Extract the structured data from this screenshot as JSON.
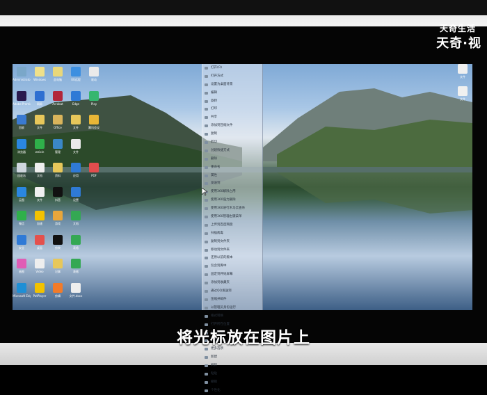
{
  "watermark": {
    "line1": "天奇生活",
    "line2": "天奇·视"
  },
  "subtitle": "将光标放在图片上",
  "desktop_icons": [
    {
      "label": "Administrator",
      "color": "#7aa7c9"
    },
    {
      "label": "Windows",
      "color": "#efe08a"
    },
    {
      "label": "此电脑",
      "color": "#e8d77a"
    },
    {
      "label": "UU远程",
      "color": "#3d8fe0"
    },
    {
      "label": "驱动",
      "color": "#eaeaea"
    },
    {
      "label": "Adobe Premiere",
      "color": "#2a1a4f"
    },
    {
      "label": "网易",
      "color": "#2e6fd1"
    },
    {
      "label": "Acrobat",
      "color": "#b2263a"
    },
    {
      "label": "Edge",
      "color": "#2f7ad6"
    },
    {
      "label": "Play",
      "color": "#36b66f"
    },
    {
      "label": "回收",
      "color": "#3a7ad1"
    },
    {
      "label": "文件",
      "color": "#e7c75a"
    },
    {
      "label": "Ofﬁce",
      "color": "#d9b45b"
    },
    {
      "label": "文件",
      "color": "#e7c75a"
    },
    {
      "label": "腾讯会议",
      "color": "#e8b636"
    },
    {
      "label": "浏览器",
      "color": "#2a87e0"
    },
    {
      "label": "weixin",
      "color": "#2fb04a"
    },
    {
      "label": "管理",
      "color": "#3a87c7"
    },
    {
      "label": "文件",
      "color": "#eaeaea"
    },
    {
      "label": "",
      "color": "#000000"
    },
    {
      "label": "回收站",
      "color": "#cfd6de"
    },
    {
      "label": "文档",
      "color": "#eeeeee"
    },
    {
      "label": "资料",
      "color": "#e7c75a"
    },
    {
      "label": "应用",
      "color": "#2f7ad6"
    },
    {
      "label": "PDF",
      "color": "#e24d4d"
    },
    {
      "label": "云图",
      "color": "#2a87e0"
    },
    {
      "label": "文件",
      "color": "#f0f0f0"
    },
    {
      "label": "抖音",
      "color": "#111111"
    },
    {
      "label": "设置",
      "color": "#2f7ad6"
    },
    {
      "label": "",
      "color": "#000000"
    },
    {
      "label": "微信",
      "color": "#2fb04a"
    },
    {
      "label": "加速",
      "color": "#f2c200"
    },
    {
      "label": "游戏",
      "color": "#e8a63a"
    },
    {
      "label": "文档",
      "color": "#34a853"
    },
    {
      "label": "",
      "color": "#000000"
    },
    {
      "label": "安全",
      "color": "#2f7ad6"
    },
    {
      "label": "桌面",
      "color": "#e4514d"
    },
    {
      "label": "剪映",
      "color": "#111111"
    },
    {
      "label": "表格",
      "color": "#34a853"
    },
    {
      "label": "",
      "color": "#000000"
    },
    {
      "label": "画图",
      "color": "#e05db5"
    },
    {
      "label": "Video",
      "color": "#eeeeee"
    },
    {
      "label": "记事",
      "color": "#e7c75a"
    },
    {
      "label": "表格",
      "color": "#34a853"
    },
    {
      "label": "",
      "color": "#000000"
    },
    {
      "label": "Microsoft Edge",
      "color": "#1e8fd6"
    },
    {
      "label": "PotPlayer",
      "color": "#f2c200"
    },
    {
      "label": "剪辑",
      "color": "#f27b2a"
    },
    {
      "label": "文件.docx",
      "color": "#eeeeee"
    },
    {
      "label": "",
      "color": "#000000"
    }
  ],
  "right_icons": [
    {
      "label": "文件"
    },
    {
      "label": "文件"
    }
  ],
  "context_menu": [
    "打开(O)",
    "打开方式",
    "设置为桌面背景",
    "编辑",
    "旋转",
    "打印",
    "共享",
    "添加到压缩文件",
    "复制",
    "剪切",
    "创建快捷方式",
    "删除",
    "重命名",
    "属性",
    "发送到",
    "使用360解除占用",
    "使用360强力删除",
    "使用360进行木马云查杀",
    "使用360管理右键菜单",
    "上传到百度网盘",
    "扫描病毒",
    "复制到文件夹",
    "移动到文件夹",
    "还原以前的版本",
    "包含到库中",
    "固定到开始屏幕",
    "添加到收藏夹",
    "通过QQ发送到",
    "压缩并邮件",
    "以管理员身份运行",
    "格式转换",
    "打开所在位置",
    "图片编辑",
    "查看属性",
    "更多选项",
    "新建",
    "刷新",
    "粘贴",
    "撤销",
    "个性化"
  ]
}
